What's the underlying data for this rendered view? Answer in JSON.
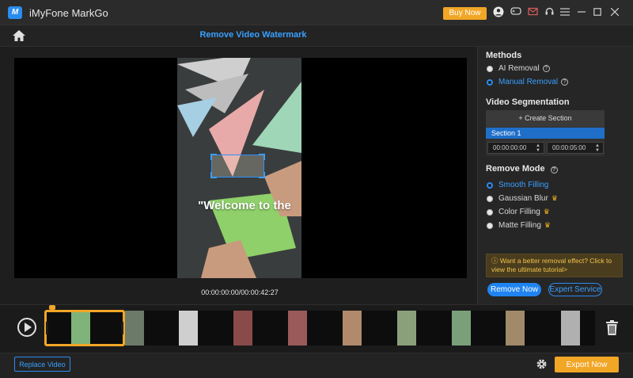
{
  "window": {
    "logo_text": "M",
    "title": "iMyFone MarkGo",
    "buy_label": "Buy Now"
  },
  "header": {
    "title": "Remove Video Watermark"
  },
  "preview": {
    "overlay_text": "\"Welcome to the",
    "time_readout": "00:00:00:00/00:00:42:27"
  },
  "panel": {
    "methods_title": "Methods",
    "methods": [
      {
        "label": "AI Removal",
        "selected": false
      },
      {
        "label": "Manual Removal",
        "selected": true
      }
    ],
    "segmentation_title": "Video Segmentation",
    "create_section_label": "+ Create Section",
    "section_label": "Section 1",
    "start_time": "00:00:00:00",
    "end_time": "00:00:05:00",
    "mode_title": "Remove Mode",
    "modes": [
      {
        "label": "Smooth Filling",
        "selected": true,
        "premium": false
      },
      {
        "label": "Gaussian Blur",
        "selected": false,
        "premium": true
      },
      {
        "label": "Color Filling",
        "selected": false,
        "premium": true
      },
      {
        "label": "Matte Filling",
        "selected": false,
        "premium": true
      }
    ],
    "tip": "Want a better removal effect? Click to view the ultimate tutorial>",
    "remove_label": "Remove Now",
    "expert_label": "Expert Service"
  },
  "bottom": {
    "replace_label": "Replace Video",
    "export_label": "Export Now"
  },
  "colors": {
    "accent": "#2a8cf0",
    "orange": "#f2a626"
  }
}
